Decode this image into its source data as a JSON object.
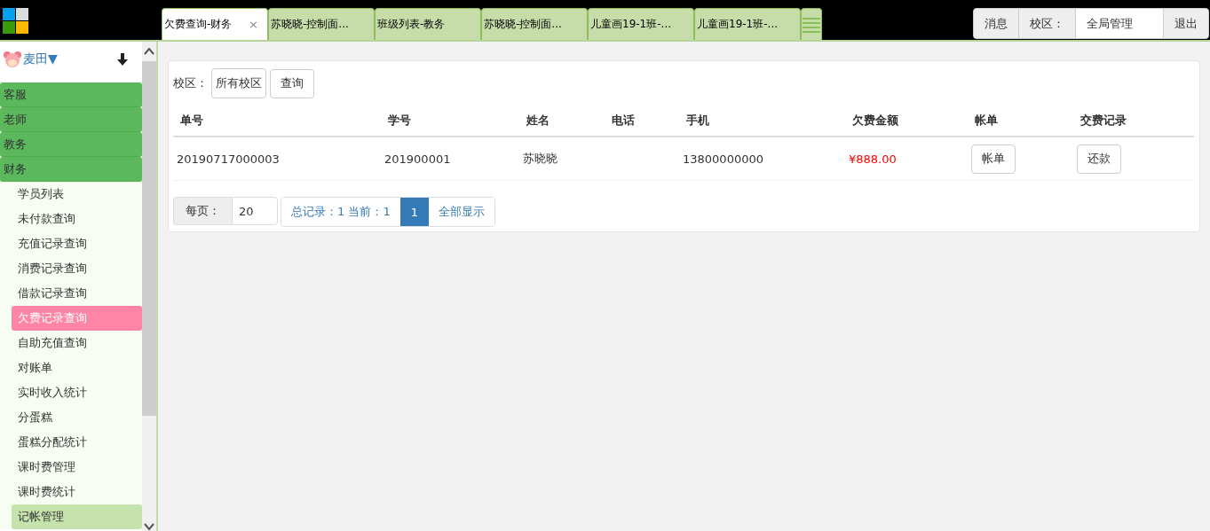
{
  "tabs": [
    {
      "label": "欠费查询-财务",
      "selected": true,
      "close": "×"
    },
    {
      "label": "苏晓晓-控制面...",
      "selected": false
    },
    {
      "label": "班级列表-教务",
      "selected": false
    },
    {
      "label": "苏晓晓-控制面...",
      "selected": false
    },
    {
      "label": "儿童画19-1班-...",
      "selected": false
    },
    {
      "label": "儿童画19-1班-...",
      "selected": false
    }
  ],
  "toolbar": {
    "messages": "消息",
    "campus_label": "校区：",
    "campus_value": "全局管理",
    "logout": "退出"
  },
  "sidebar": {
    "user": "麦田▼",
    "groups": [
      {
        "label": "客服"
      },
      {
        "label": "老师"
      },
      {
        "label": "教务"
      },
      {
        "label": "财务",
        "items": [
          {
            "label": "学员列表",
            "selected": false,
            "hovered": false
          },
          {
            "label": "未付款查询",
            "selected": false,
            "hovered": false
          },
          {
            "label": "充值记录查询",
            "selected": false,
            "hovered": false
          },
          {
            "label": "消费记录查询",
            "selected": false,
            "hovered": false
          },
          {
            "label": "借款记录查询",
            "selected": false,
            "hovered": false
          },
          {
            "label": "欠费记录查询",
            "selected": true,
            "hovered": false
          },
          {
            "label": "自助充值查询",
            "selected": false,
            "hovered": false
          },
          {
            "label": "对账单",
            "selected": false,
            "hovered": false
          },
          {
            "label": "实时收入统计",
            "selected": false,
            "hovered": false
          },
          {
            "label": "分蛋糕",
            "selected": false,
            "hovered": false
          },
          {
            "label": "蛋糕分配统计",
            "selected": false,
            "hovered": false
          },
          {
            "label": "课时费管理",
            "selected": false,
            "hovered": false
          },
          {
            "label": "课时费统计",
            "selected": false,
            "hovered": false
          },
          {
            "label": "记帐管理",
            "selected": false,
            "hovered": true
          }
        ]
      }
    ]
  },
  "filter": {
    "label": "校区：",
    "campus": "所有校区",
    "query_button": "查询"
  },
  "table": {
    "columns": [
      "单号",
      "学号",
      "姓名",
      "电话",
      "手机",
      "欠费金额",
      "帐单",
      "交费记录"
    ],
    "rows": [
      {
        "order_no": "20190717000003",
        "student_no": "201900001",
        "name": "苏晓晓",
        "mobile": "13800000000",
        "amount": "¥888.00",
        "bill_button": "帐单",
        "repay_button": "还款"
      }
    ]
  },
  "pagination": {
    "per_page_label": "每页：",
    "per_page": "20",
    "summary": "总记录：1 当前：1",
    "pages": [
      {
        "label": "1",
        "selected": true
      }
    ],
    "show_all": "全部显示"
  }
}
